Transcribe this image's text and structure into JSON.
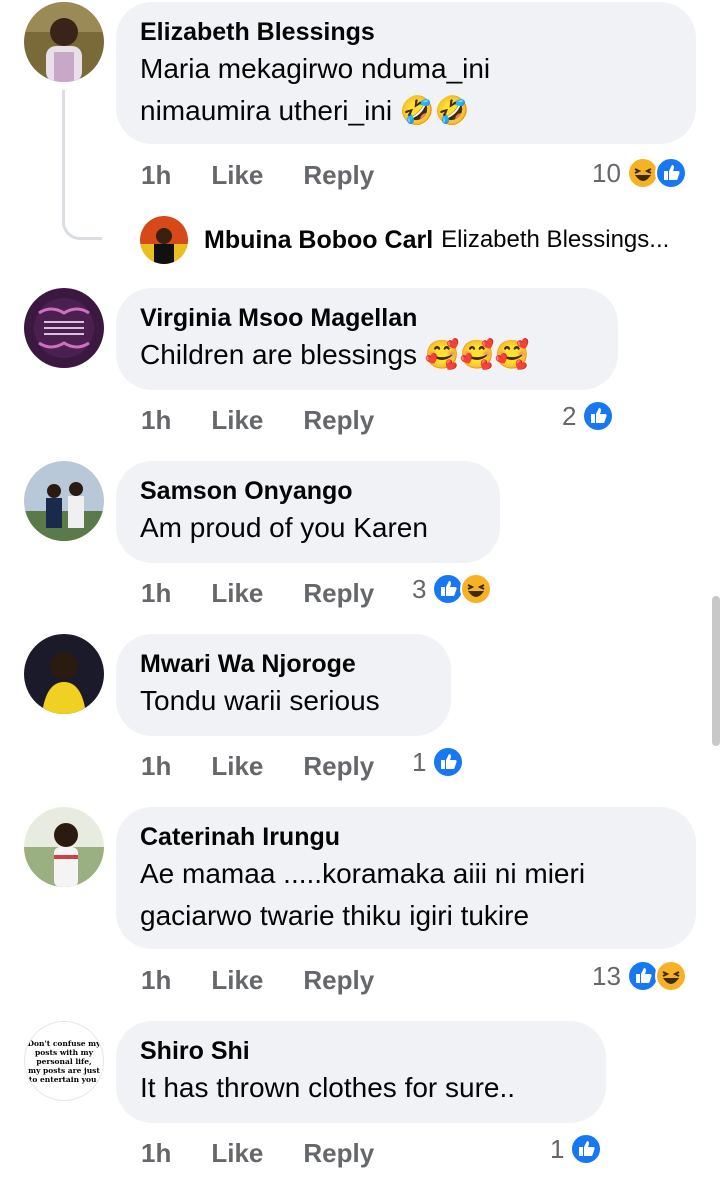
{
  "colors": {
    "like_blue": "#1877f2",
    "haha_yellow": "#f7b125",
    "bubble_bg": "#f0f2f5",
    "meta_gray": "#65676b"
  },
  "labels": {
    "like": "Like",
    "reply": "Reply"
  },
  "comments": [
    {
      "author": "Elizabeth Blessings",
      "text_lines": [
        "Maria mekagirwo nduma_ini",
        "nimaumira utheri_ini 🤣🤣"
      ],
      "time": "1h",
      "reaction_count": "10",
      "reaction_icons": [
        "haha-icon",
        "like-icon"
      ],
      "reply_preview": {
        "author": "Mbuina Boboo Carl",
        "text": "Elizabeth Blessings..."
      }
    },
    {
      "author": "Virginia Msoo Magellan",
      "text_lines": [
        "Children are blessings 🥰🥰🥰"
      ],
      "time": "1h",
      "reaction_count": "2",
      "reaction_icons": [
        "like-icon"
      ]
    },
    {
      "author": "Samson Onyango",
      "text_lines": [
        "Am proud of you Karen"
      ],
      "time": "1h",
      "reaction_count": "3",
      "reaction_icons": [
        "like-icon",
        "haha-icon"
      ]
    },
    {
      "author": "Mwari Wa Njoroge",
      "text_lines": [
        "Tondu warii serious"
      ],
      "time": "1h",
      "reaction_count": "1",
      "reaction_icons": [
        "like-icon"
      ]
    },
    {
      "author": "Caterinah Irungu",
      "text_lines": [
        "Ae mamaa .....koramaka aiii ni mieri",
        "gaciarwo twarie thiku igiri tukire"
      ],
      "time": "1h",
      "reaction_count": "13",
      "reaction_icons": [
        "like-icon",
        "haha-icon"
      ]
    },
    {
      "author": "Shiro Shi",
      "text_lines": [
        "It has thrown clothes for sure.."
      ],
      "time": "1h",
      "reaction_count": "1",
      "reaction_icons": [
        "like-icon"
      ],
      "avatar_text": [
        "Don't confuse my",
        "posts with my",
        "personal life,",
        "my posts are just",
        "to entertain you."
      ]
    }
  ]
}
